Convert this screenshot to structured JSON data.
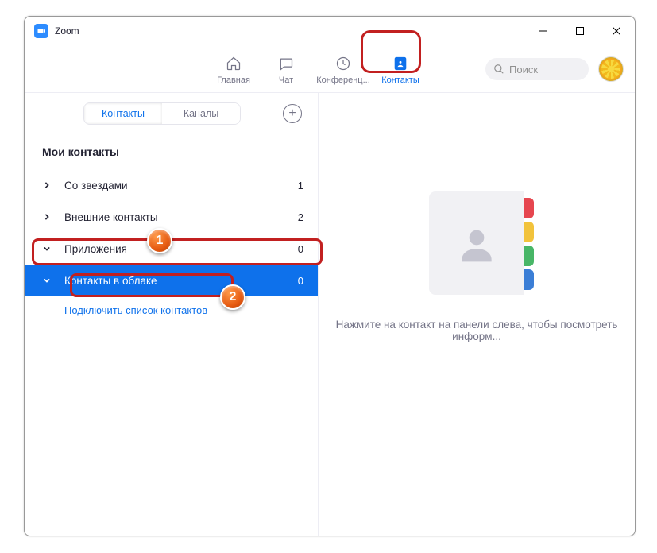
{
  "window": {
    "title": "Zoom"
  },
  "nav": {
    "home": "Главная",
    "chat": "Чат",
    "meetings": "Конференц...",
    "contacts": "Контакты"
  },
  "search": {
    "placeholder": "Поиск"
  },
  "segmented": {
    "contacts": "Контакты",
    "channels": "Каналы"
  },
  "section_title": "Мои контакты",
  "rows": {
    "starred": {
      "label": "Со звездами",
      "count": "1"
    },
    "external": {
      "label": "Внешние контакты",
      "count": "2"
    },
    "apps": {
      "label": "Приложения",
      "count": "0"
    },
    "cloud": {
      "label": "Контакты в облаке",
      "count": "0"
    }
  },
  "sublink": "Подключить список контактов",
  "hint": "Нажмите на контакт на панели слева, чтобы посмотреть информ...",
  "badges": {
    "one": "1",
    "two": "2"
  },
  "ill_colors": [
    "#e6464f",
    "#f2c33c",
    "#48b667",
    "#3b7ed6"
  ]
}
